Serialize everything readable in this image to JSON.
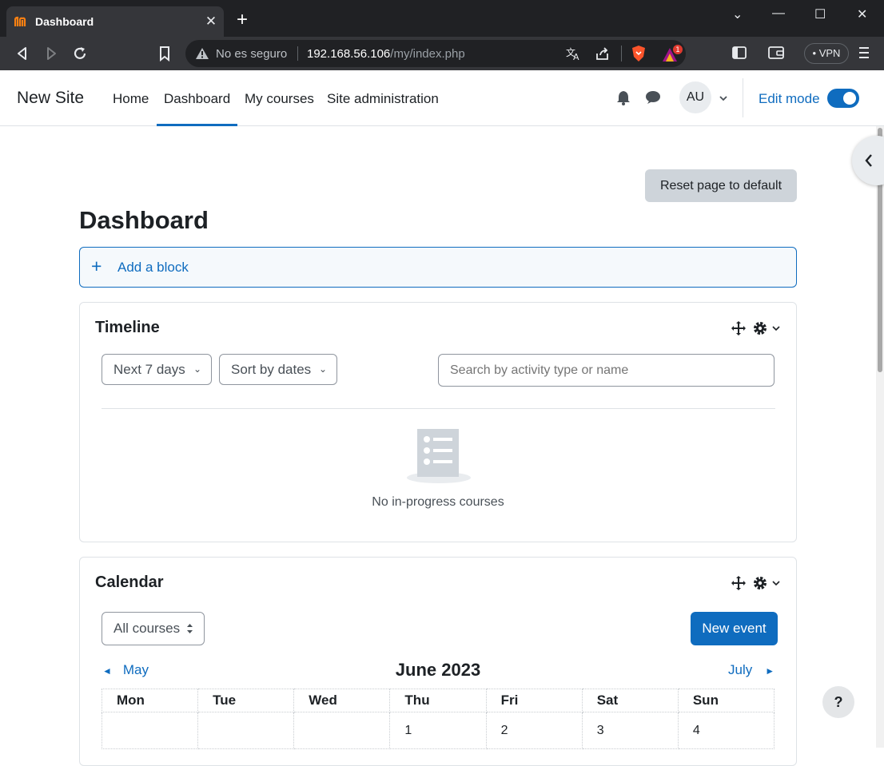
{
  "browser": {
    "tab_title": "Dashboard",
    "tab_close": "✕",
    "new_tab": "+",
    "security_label": "No es seguro",
    "url_host": "192.168.56.106",
    "url_path": "/my/index.php",
    "vpn_label": "• VPN",
    "shield_badge": "1",
    "window_controls": [
      "⌄",
      "—",
      "☐",
      "✕"
    ]
  },
  "navbar": {
    "site_name": "New Site",
    "links": [
      {
        "label": "Home",
        "active": false
      },
      {
        "label": "Dashboard",
        "active": true
      },
      {
        "label": "My courses",
        "active": false
      },
      {
        "label": "Site administration",
        "active": false
      }
    ],
    "avatar_initials": "AU",
    "edit_mode_label": "Edit mode",
    "edit_mode_on": true
  },
  "page": {
    "reset_label": "Reset page to default",
    "title": "Dashboard",
    "add_block_label": "Add a block"
  },
  "timeline": {
    "title": "Timeline",
    "filter_label": "Next 7 days",
    "sort_label": "Sort by dates",
    "search_placeholder": "Search by activity type or name",
    "empty_text": "No in-progress courses"
  },
  "calendar": {
    "title": "Calendar",
    "course_filter": "All courses",
    "new_event_label": "New event",
    "prev_month": "May",
    "next_month": "July",
    "month_title": "June 2023",
    "weekdays": [
      "Mon",
      "Tue",
      "Wed",
      "Thu",
      "Fri",
      "Sat",
      "Sun"
    ],
    "first_week": [
      "",
      "",
      "",
      "1",
      "2",
      "3",
      "4"
    ]
  },
  "help_label": "?",
  "colors": {
    "primary": "#0f6cbf",
    "chrome_dark": "#202124",
    "chrome_toolbar": "#35363a",
    "secondary_button": "#ced4da"
  }
}
